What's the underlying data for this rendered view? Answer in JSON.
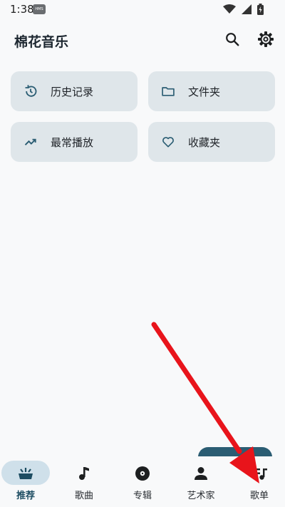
{
  "status_bar": {
    "time": "1:38",
    "badge": "HMS"
  },
  "header": {
    "title": "棉花音乐"
  },
  "cards": [
    {
      "label": "历史记录",
      "icon": "history-icon"
    },
    {
      "label": "文件夹",
      "icon": "folder-icon"
    },
    {
      "label": "最常播放",
      "icon": "trending-up-icon"
    },
    {
      "label": "收藏夹",
      "icon": "heart-icon"
    }
  ],
  "nav": {
    "items": [
      {
        "label": "推荐",
        "icon": "recommend-icon",
        "active": true
      },
      {
        "label": "歌曲",
        "icon": "music-note-icon"
      },
      {
        "label": "专辑",
        "icon": "album-icon"
      },
      {
        "label": "艺术家",
        "icon": "person-icon"
      },
      {
        "label": "歌单",
        "icon": "playlist-icon"
      }
    ]
  },
  "colors": {
    "accent": "#2b5d73",
    "card_bg": "#dfe6ea",
    "active_pill": "#cfe0ea",
    "annotation_arrow": "#e8141b"
  }
}
